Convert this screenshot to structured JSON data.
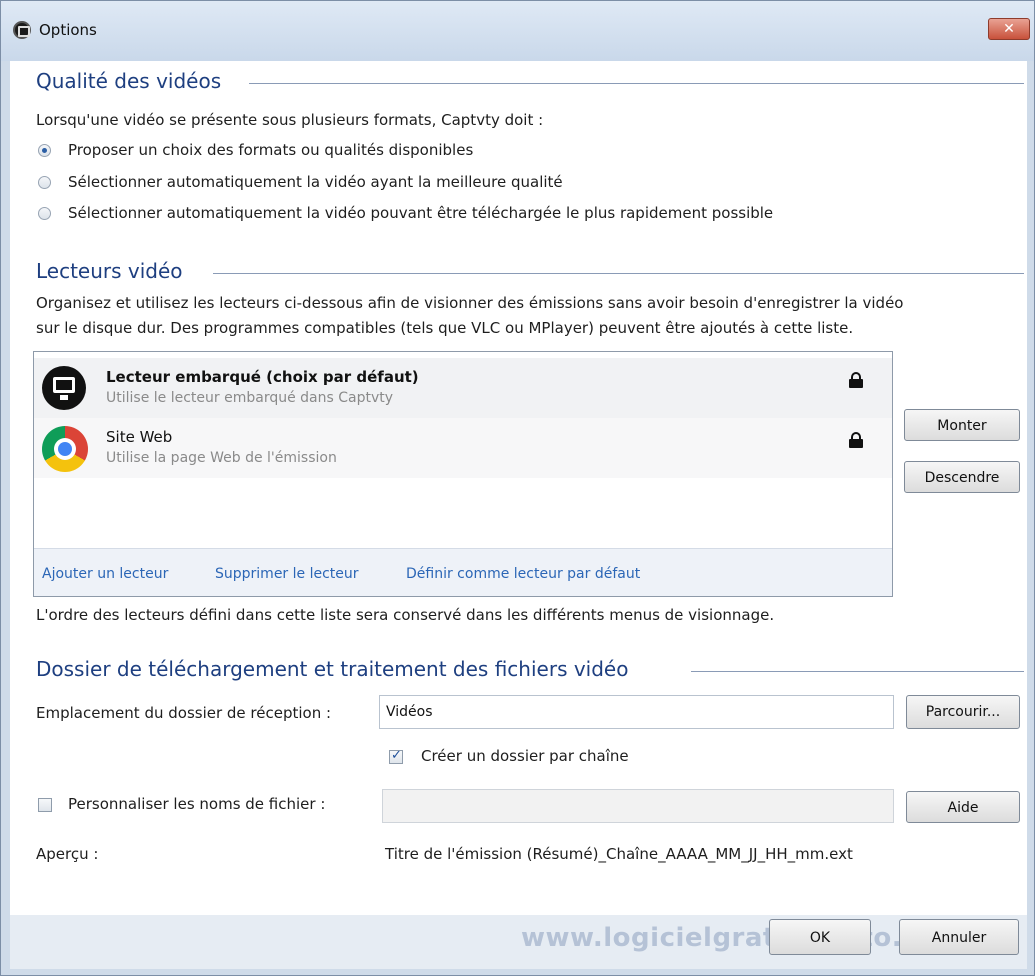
{
  "window": {
    "title": "Options",
    "close_label": "✕"
  },
  "video_quality": {
    "title": "Qualité des vidéos",
    "intro": "Lorsqu'une vidéo se présente sous plusieurs formats, Captvty doit :",
    "options": [
      {
        "label": "Proposer un choix des formats ou qualités disponibles",
        "checked": true
      },
      {
        "label": "Sélectionner automatiquement la vidéo ayant la meilleure qualité",
        "checked": false
      },
      {
        "label": "Sélectionner automatiquement la vidéo pouvant être téléchargée le plus rapidement possible",
        "checked": false
      }
    ]
  },
  "players": {
    "title": "Lecteurs vidéo",
    "desc_line1": "Organisez et utilisez les lecteurs ci-dessous afin de visionner des émissions sans avoir besoin d'enregistrer la vidéo",
    "desc_line2": "sur le disque dur. Des programmes compatibles (tels que VLC ou MPlayer) peuvent être ajoutés à cette liste.",
    "items": [
      {
        "name": "Lecteur embarqué (choix par défaut)",
        "description": "Utilise le lecteur embarqué dans Captvty",
        "icon": "monitor-icon",
        "locked": true
      },
      {
        "name": "Site Web",
        "description": "Utilise la page Web de l'émission",
        "icon": "chrome-icon",
        "locked": true
      }
    ],
    "links": {
      "add": "Ajouter un lecteur",
      "remove": "Supprimer le lecteur",
      "set_default": "Définir comme lecteur par défaut"
    },
    "up_button": "Monter",
    "down_button": "Descendre",
    "order_note": "L'ordre des lecteurs défini dans cette liste sera conservé dans les différents menus de visionnage."
  },
  "download": {
    "title": "Dossier de téléchargement et traitement des fichiers vidéo",
    "location_label": "Emplacement du dossier de réception :",
    "location_value": "Vidéos",
    "browse_button": "Parcourir...",
    "per_channel_label": "Créer un dossier par chaîne",
    "per_channel_checked": true,
    "custom_names_label": "Personnaliser les noms de fichier :",
    "custom_names_checked": false,
    "custom_names_value": "",
    "help_button": "Aide",
    "preview_label": "Aperçu :",
    "preview_value": "Titre de l'émission (Résumé)_Chaîne_AAAA_MM_JJ_HH_mm.ext"
  },
  "footer": {
    "watermark": "www.logicielgratuit-tuto.com",
    "ok_button": "OK",
    "cancel_button": "Annuler"
  },
  "colors": {
    "section_title": "#1e3f80",
    "link": "#2b66b6",
    "close_button": "#c8513b"
  }
}
